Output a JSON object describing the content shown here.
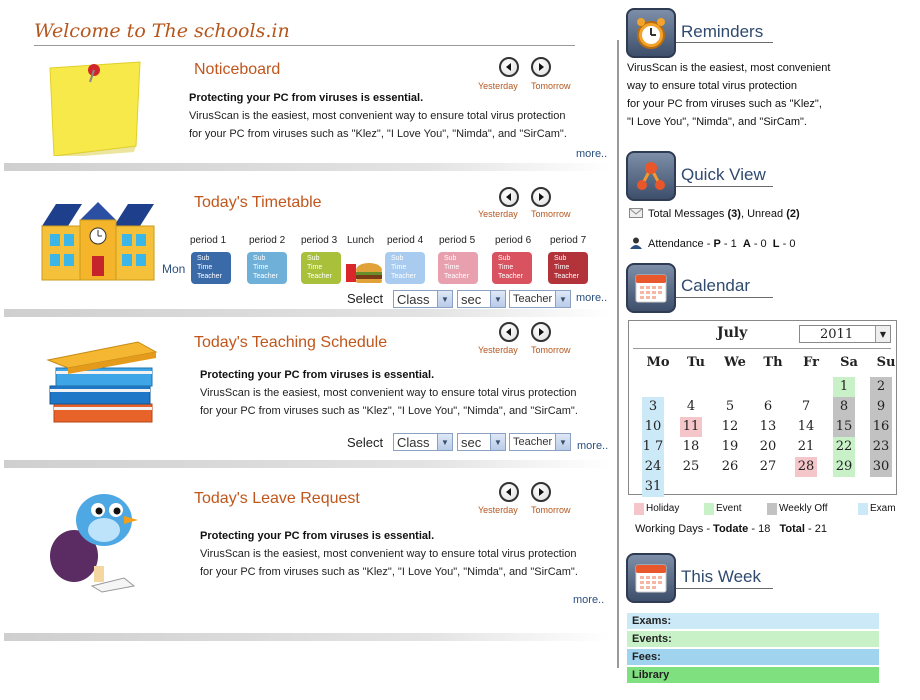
{
  "header": {
    "welcome": "Welcome to The schools.in"
  },
  "nav": {
    "yesterday": "Yesterday",
    "tomorrow": "Tomorrow",
    "more": "more.."
  },
  "noticeboard": {
    "title": "Noticeboard",
    "headline": "Protecting your PC from viruses is essential.",
    "line1": "VirusScan is the easiest, most convenient way to  ensure total virus protection",
    "line2": "for your PC from viruses such as \"Klez\", \"I Love You\", \"Nimda\", and \"SirCam\"."
  },
  "timetable": {
    "title": "Today's Timetable",
    "day": "Mon",
    "periods": [
      {
        "label": "period 1",
        "color": "#3a6aa8",
        "l1": "Sub",
        "l2": "Time",
        "l3": "Teacher"
      },
      {
        "label": "period 2",
        "color": "#6fb0d8",
        "l1": "Sub",
        "l2": "Time",
        "l3": "Teacher"
      },
      {
        "label": "period 3",
        "color": "#a9c13a",
        "l1": "Sub",
        "l2": "Time",
        "l3": "Teacher"
      },
      {
        "label": "Lunch"
      },
      {
        "label": "period 4",
        "color": "#a8cbef",
        "l1": "Sub",
        "l2": "Time",
        "l3": "Teacher"
      },
      {
        "label": "period 5",
        "color": "#e9a0ae",
        "l1": "Sub",
        "l2": "Time",
        "l3": "Teacher"
      },
      {
        "label": "period 6",
        "color": "#d9525f",
        "l1": "Sub",
        "l2": "Time",
        "l3": "Teacher"
      },
      {
        "label": "period 7",
        "color": "#b2333a",
        "l1": "Sub",
        "l2": "Time",
        "l3": "Teacher"
      }
    ],
    "select_label": "Select",
    "class_value": "Class",
    "sec_value": "sec",
    "teacher_value": "Teacher"
  },
  "teaching": {
    "title": "Today's Teaching Schedule",
    "headline": "Protecting your PC from viruses is essential.",
    "line1": "VirusScan is the easiest, most convenient way to  ensure total virus protection",
    "line2": "for your PC from viruses such as \"Klez\", \"I Love You\", \"Nimda\", and \"SirCam\".",
    "select_label": "Select",
    "class_value": "Class",
    "sec_value": "sec",
    "teacher_value": "Teacher"
  },
  "leave": {
    "title": "Today's Leave Request",
    "headline": "Protecting your PC from viruses is essential.",
    "line1": "VirusScan is the easiest, most convenient way to  ensure total virus protection",
    "line2": "for your PC from viruses such as \"Klez\", \"I Love You\", \"Nimda\", and \"SirCam\"."
  },
  "reminders": {
    "title": "Reminders",
    "lines": [
      "VirusScan is the easiest, most convenient",
      "way to  ensure total virus protection",
      "for your PC from viruses such as \"Klez\",",
      "\"I Love You\", \"Nimda\", and \"SirCam\"."
    ]
  },
  "quickview": {
    "title": "Quick View",
    "messages_prefix": "Total Messages",
    "messages_total": "(3)",
    "unread_prefix": ", Unread",
    "unread_count": "(2)",
    "attendance_prefix": "Attendance -",
    "p_label": "P",
    "p_value": "- 1",
    "a_label": "A",
    "a_value": "- 0",
    "l_label": "L",
    "l_value": "- 0"
  },
  "calendar": {
    "title": "Calendar",
    "month": "July",
    "year": "2011",
    "weekdays": [
      "Mo",
      "Tu",
      "We",
      "Th",
      "Fr",
      "Sa",
      "Su"
    ],
    "colors": {
      "holiday": "#f5c6c9",
      "event": "#c8f1c8",
      "weekly_off": "#c2c2c2",
      "exam": "#cce9f7"
    },
    "days": [
      {
        "d": "1",
        "col": 5,
        "row": 0,
        "type": "event"
      },
      {
        "d": "2",
        "col": 6,
        "row": 0,
        "type": "weekly_off"
      },
      {
        "d": "3",
        "col": 0,
        "row": 1,
        "type": "exam"
      },
      {
        "d": "4",
        "col": 1,
        "row": 1
      },
      {
        "d": "5",
        "col": 2,
        "row": 1
      },
      {
        "d": "6",
        "col": 3,
        "row": 1
      },
      {
        "d": "7",
        "col": 4,
        "row": 1
      },
      {
        "d": "8",
        "col": 5,
        "row": 1,
        "type": "weekly_off"
      },
      {
        "d": "9",
        "col": 6,
        "row": 1,
        "type": "weekly_off"
      },
      {
        "d": "10",
        "col": 0,
        "row": 2,
        "type": "exam"
      },
      {
        "d": "11",
        "col": 1,
        "row": 2,
        "type": "holiday"
      },
      {
        "d": "12",
        "col": 2,
        "row": 2
      },
      {
        "d": "13",
        "col": 3,
        "row": 2
      },
      {
        "d": "14",
        "col": 4,
        "row": 2
      },
      {
        "d": "15",
        "col": 5,
        "row": 2,
        "type": "weekly_off"
      },
      {
        "d": "16",
        "col": 6,
        "row": 2,
        "type": "weekly_off"
      },
      {
        "d": "1 7",
        "col": 0,
        "row": 3,
        "type": "exam"
      },
      {
        "d": "18",
        "col": 1,
        "row": 3
      },
      {
        "d": "19",
        "col": 2,
        "row": 3
      },
      {
        "d": "20",
        "col": 3,
        "row": 3
      },
      {
        "d": "21",
        "col": 4,
        "row": 3
      },
      {
        "d": "22",
        "col": 5,
        "row": 3,
        "type": "event"
      },
      {
        "d": "23",
        "col": 6,
        "row": 3,
        "type": "weekly_off"
      },
      {
        "d": "24",
        "col": 0,
        "row": 4,
        "type": "exam"
      },
      {
        "d": "25",
        "col": 1,
        "row": 4
      },
      {
        "d": "26",
        "col": 2,
        "row": 4
      },
      {
        "d": "27",
        "col": 3,
        "row": 4
      },
      {
        "d": "28",
        "col": 4,
        "row": 4,
        "type": "holiday"
      },
      {
        "d": "29",
        "col": 5,
        "row": 4,
        "type": "event"
      },
      {
        "d": "30",
        "col": 6,
        "row": 4,
        "type": "weekly_off"
      },
      {
        "d": "31",
        "col": 0,
        "row": 5,
        "type": "exam"
      }
    ],
    "legend": {
      "holiday": "Holiday",
      "event": "Event",
      "weekly_off": "Weekly Off",
      "exam": "Exam"
    },
    "working_days_label": "Working Days  -",
    "todate_label": "Todate",
    "todate_value": "- 18",
    "total_label": "Total",
    "total_value": "- 21"
  },
  "thisweek": {
    "title": "This Week",
    "rows": [
      {
        "label": "Exams:",
        "color": "#cce9f7"
      },
      {
        "label": "Events:",
        "color": "#c8f1c8"
      },
      {
        "label": "Fees:",
        "color": "#9fd3ee"
      },
      {
        "label": "Library",
        "color": "#7fe07f"
      }
    ]
  }
}
